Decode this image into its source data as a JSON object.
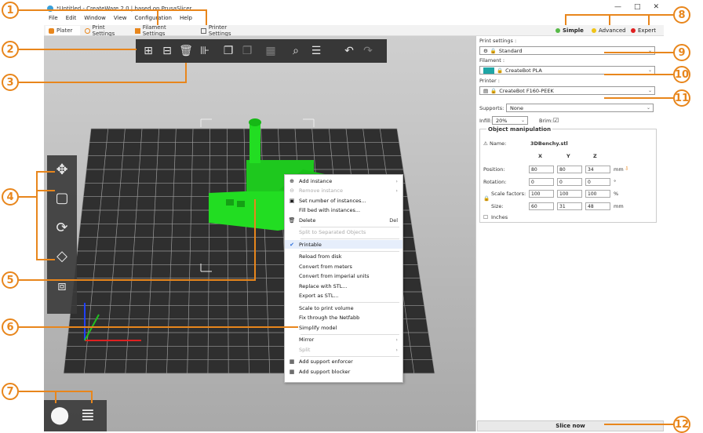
{
  "window": {
    "title": "*Untitled - CreateWare 2.0 | based on PrusaSlicer",
    "controls": [
      "—",
      "□",
      "✕"
    ]
  },
  "menu": [
    "File",
    "Edit",
    "Window",
    "View",
    "Configuration",
    "Help"
  ],
  "tabs": [
    {
      "label": "Plater"
    },
    {
      "label": "Print Settings"
    },
    {
      "label": "Filament Settings"
    },
    {
      "label": "Printer Settings"
    }
  ],
  "modes": [
    {
      "label": "Simple",
      "color": "#57b947"
    },
    {
      "label": "Advanced",
      "color": "#f0c419"
    },
    {
      "label": "Expert",
      "color": "#e02020"
    }
  ],
  "toolbar_icons": [
    "add-icon",
    "delete-icon",
    "delete-all-icon",
    "arrange-icon",
    "copy-icon",
    "paste-icon",
    "add-instance-icon",
    "search-icon",
    "layers-icon",
    "undo-icon",
    "redo-icon"
  ],
  "context_menu": [
    {
      "label": "Add instance",
      "icon": "⊕",
      "sub": "›",
      "disabled": false
    },
    {
      "label": "Remove instance",
      "icon": "⊖",
      "sub": "›",
      "disabled": true
    },
    {
      "label": "Set number of instances...",
      "icon": "▣",
      "disabled": false
    },
    {
      "label": "Fill bed with instances...",
      "icon": "",
      "disabled": false
    },
    {
      "label": "Delete",
      "icon": "🗑",
      "key": "Del",
      "disabled": false
    },
    {
      "label": "Split to Separated Objects",
      "icon": "",
      "disabled": true
    },
    {
      "label": "Printable",
      "icon": "✔",
      "disabled": false,
      "highlight": true
    },
    {
      "label": "Reload from disk",
      "icon": "",
      "disabled": false
    },
    {
      "label": "Convert from meters",
      "icon": "",
      "disabled": false
    },
    {
      "label": "Convert from imperial units",
      "icon": "",
      "disabled": false
    },
    {
      "label": "Replace with STL...",
      "icon": "",
      "disabled": false
    },
    {
      "label": "Export as STL...",
      "icon": "",
      "disabled": false
    },
    {
      "label": "Scale to print volume",
      "icon": "",
      "disabled": false
    },
    {
      "label": "Fix through the Netfabb",
      "icon": "",
      "disabled": false
    },
    {
      "label": "Simplify model",
      "icon": "",
      "disabled": false
    },
    {
      "label": "Mirror",
      "icon": "",
      "sub": "›",
      "disabled": false
    },
    {
      "label": "Split",
      "icon": "",
      "sub": "›",
      "disabled": true
    },
    {
      "label": "Add support enforcer",
      "icon": "▦",
      "disabled": false
    },
    {
      "label": "Add support blocker",
      "icon": "▦",
      "disabled": false
    }
  ],
  "panel": {
    "print_settings_label": "Print settings :",
    "print_settings_value": "Standard",
    "filament_label": "Filament :",
    "filament_value": "CreateBot PLA",
    "filament_color": "#1fa6a6",
    "printer_label": "Printer :",
    "printer_value": "CreateBot F160-PEEK",
    "supports_label": "Supports:",
    "supports_value": "None",
    "infill_label": "Infill:",
    "infill_value": "20%",
    "brim_label": "Brim:",
    "brim_checked": "☑",
    "object_manipulation": "Object manipulation",
    "name_label": "Name:",
    "name_value": "3DBenchy.stl",
    "axes": [
      "X",
      "Y",
      "Z"
    ],
    "position_label": "Position:",
    "position": [
      "80",
      "80",
      "34"
    ],
    "position_unit": "mm",
    "rotation_label": "Rotation:",
    "rotation": [
      "0",
      "0",
      "0"
    ],
    "rotation_unit": "°",
    "scale_label": "Scale factors:",
    "scale": [
      "100",
      "100",
      "100"
    ],
    "scale_unit": "%",
    "size_label": "Size:",
    "size": [
      "60",
      "31",
      "48"
    ],
    "size_unit": "mm",
    "inches_label": "Inches"
  },
  "slice_button": "Slice now",
  "callouts": [
    "1",
    "2",
    "3",
    "4",
    "5",
    "6",
    "7",
    "8",
    "9",
    "10",
    "11",
    "12"
  ]
}
